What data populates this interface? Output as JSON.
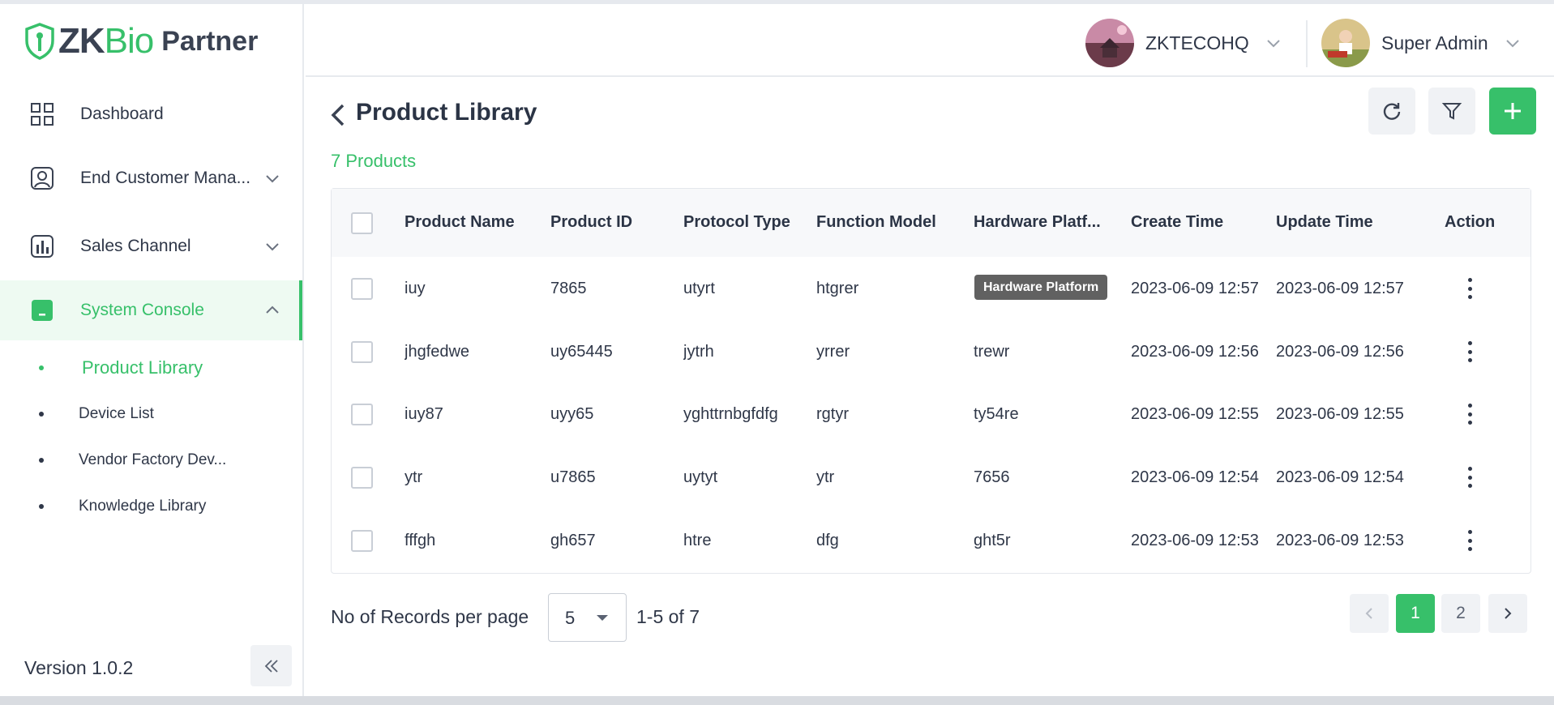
{
  "brand": {
    "zk": "ZK",
    "bio": "Bio",
    "partner": "Partner",
    "accent": "#37c06a"
  },
  "sidebar": {
    "items": [
      {
        "label": "Dashboard",
        "icon": "grid-icon"
      },
      {
        "label": "End Customer Mana...",
        "icon": "user-badge-icon"
      },
      {
        "label": "Sales Channel",
        "icon": "bar-chart-icon"
      },
      {
        "label": "System Console",
        "icon": "console-icon",
        "active": true
      }
    ],
    "subitems": [
      {
        "label": "Product Library",
        "active": true
      },
      {
        "label": "Device List"
      },
      {
        "label": "Vendor Factory Dev..."
      },
      {
        "label": "Knowledge Library"
      }
    ],
    "version": "Version 1.0.2"
  },
  "header": {
    "org": "ZKTECOHQ",
    "user": "Super Admin"
  },
  "page": {
    "title": "Product Library",
    "count": "7 Products"
  },
  "table": {
    "columns": [
      "Product Name",
      "Product ID",
      "Protocol Type",
      "Function Model",
      "Hardware Platf...",
      "Create Time",
      "Update Time",
      "Action"
    ],
    "rows": [
      {
        "name": "iuy",
        "id": "7865",
        "protocol": "utyrt",
        "model": "htgrer",
        "hardware": "",
        "created": "2023-06-09 12:57",
        "updated": "2023-06-09 12:57"
      },
      {
        "name": "jhgfedwe",
        "id": "uy65445",
        "protocol": "jytrh",
        "model": "yrrer",
        "hardware": "trewr",
        "created": "2023-06-09 12:56",
        "updated": "2023-06-09 12:56"
      },
      {
        "name": "iuy87",
        "id": "uyy65",
        "protocol": "yghttrnbgfdfg",
        "model": "rgtyr",
        "hardware": "ty54re",
        "created": "2023-06-09 12:55",
        "updated": "2023-06-09 12:55"
      },
      {
        "name": "ytr",
        "id": "u7865",
        "protocol": "uytyt",
        "model": "ytr",
        "hardware": "7656",
        "created": "2023-06-09 12:54",
        "updated": "2023-06-09 12:54"
      },
      {
        "name": "fffgh",
        "id": "gh657",
        "protocol": "htre",
        "model": "dfg",
        "hardware": "ght5r",
        "created": "2023-06-09 12:53",
        "updated": "2023-06-09 12:53"
      }
    ],
    "tooltip": "Hardware Platform"
  },
  "pagination": {
    "rpp_label": "No of Records per page",
    "rpp_value": "5",
    "range": "1-5 of 7",
    "pages": [
      "1",
      "2"
    ],
    "current": "1"
  }
}
